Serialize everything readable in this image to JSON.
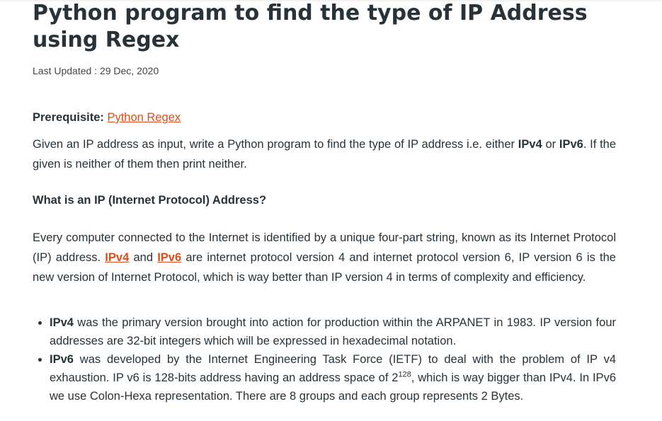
{
  "article": {
    "title": "Python program to find the type of IP Address using Regex",
    "last_updated": "Last Updated : 29 Dec, 2020",
    "prerequisite_label": "Prerequisite:",
    "prerequisite_link": "Python Regex",
    "intro": {
      "t1": "Given an IP address as input, write a Python program to find the type of IP address i.e. either ",
      "b1": "IPv4",
      "t2": " or ",
      "b2": "IPv6",
      "t3": ". If the given is neither of them then print neither."
    },
    "section_heading": "What is an IP (Internet Protocol) Address?",
    "explain": {
      "t1": "Every computer connected to the Internet is identified by a unique four-part string, known as its Internet Protocol (IP) address. ",
      "link1": "IPv4",
      "t2": " and ",
      "link2": "IPv6",
      "t3": " are internet protocol version 4 and internet protocol version 6, IP version 6 is the new version of Internet Protocol, which is way better than IP version 4 in terms of complexity and efficiency."
    },
    "bullets": [
      {
        "bold": "IPv4",
        "text": " was the primary version brought into action for production within the ARPANET in 1983. IP version four addresses are 32-bit integers which will be expressed in hexadecimal notation."
      },
      {
        "bold": "IPv6",
        "text_before": " was developed by the Internet Engineering Task Force (IETF) to deal with the problem of IP v4 exhaustion. IP v6 is 128-bits address having an address space of 2",
        "sup": "128",
        "text_after": ", which is way bigger than IPv4. In IPv6 we use Colon-Hexa representation. There are 8 groups and each group represents 2 Bytes."
      }
    ]
  }
}
